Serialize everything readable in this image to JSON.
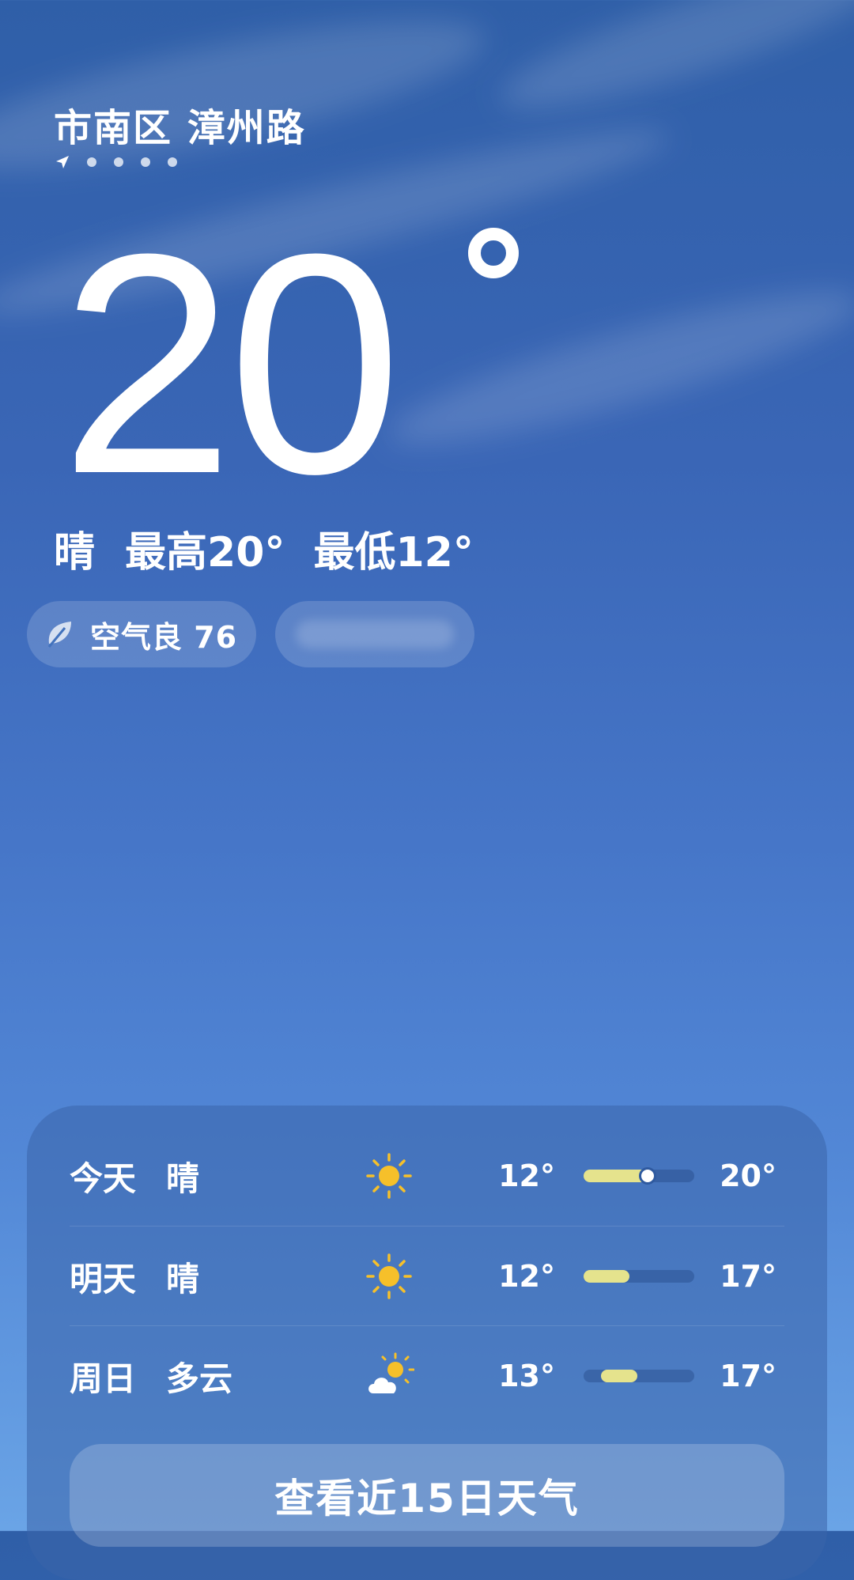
{
  "location": {
    "district": "市南区",
    "street": "漳州路"
  },
  "current": {
    "temperature": "20",
    "condition": "晴",
    "high_label": "最高20°",
    "low_label": "最低12°"
  },
  "aqi": {
    "label": "空气良 76"
  },
  "forecast": [
    {
      "day": "今天",
      "condition": "晴",
      "icon": "sun-icon",
      "low": "12°",
      "high": "20°",
      "low_value": 12,
      "high_value": 20,
      "current_value": 20
    },
    {
      "day": "明天",
      "condition": "晴",
      "icon": "sun-icon",
      "low": "12°",
      "high": "17°",
      "low_value": 12,
      "high_value": 17
    },
    {
      "day": "周日",
      "condition": "多云",
      "icon": "partly-cloudy-icon",
      "low": "13°",
      "high": "17°",
      "low_value": 13,
      "high_value": 17
    }
  ],
  "more_button": {
    "label": "查看近15日天气"
  },
  "colors": {
    "bar_fill": "#e5e38d",
    "sun": "#f6c02a"
  }
}
